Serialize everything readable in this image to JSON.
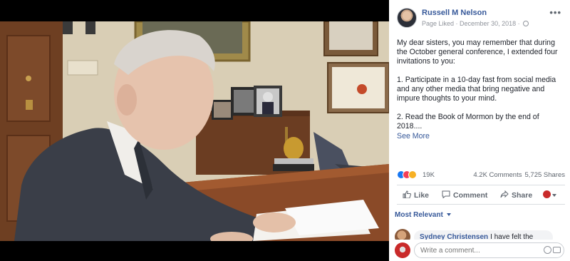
{
  "photo": {
    "alt": "Russell M Nelson reading at a desk"
  },
  "post": {
    "author": "Russell M Nelson",
    "page_liked": "Page Liked",
    "date": "December 30, 2018",
    "separator": " · ",
    "more_icon": "more-dots-icon",
    "paragraphs": [
      "My dear sisters, you may remember that during the October general conference, I extended four invitations to you:",
      "1. Participate in a 10-day fast from social media and any other media that bring negative and impure thoughts to your mind.",
      "2. Read the Book of Mormon by the end of 2018...."
    ],
    "see_more": "See More"
  },
  "reactions": {
    "count": "19K",
    "comments": "4.2K Comments",
    "shares": "5,725 Shares",
    "icons": [
      "like-reaction-icon",
      "love-reaction-icon",
      "wow-reaction-icon"
    ],
    "colors": {
      "like": "#1877f2",
      "love": "#f33e58",
      "wow": "#f7b125"
    }
  },
  "actions": {
    "like": "Like",
    "comment": "Comment",
    "share": "Share"
  },
  "comments": {
    "sort_label": "Most Relevant",
    "items": [
      {
        "name": "Sydney Christensen",
        "text": "I have felt the"
      }
    ],
    "write_placeholder": "Write a comment..."
  },
  "colors": {
    "link": "#365899",
    "text": "#1d2129",
    "muted": "#90949c",
    "background": "#000000"
  }
}
